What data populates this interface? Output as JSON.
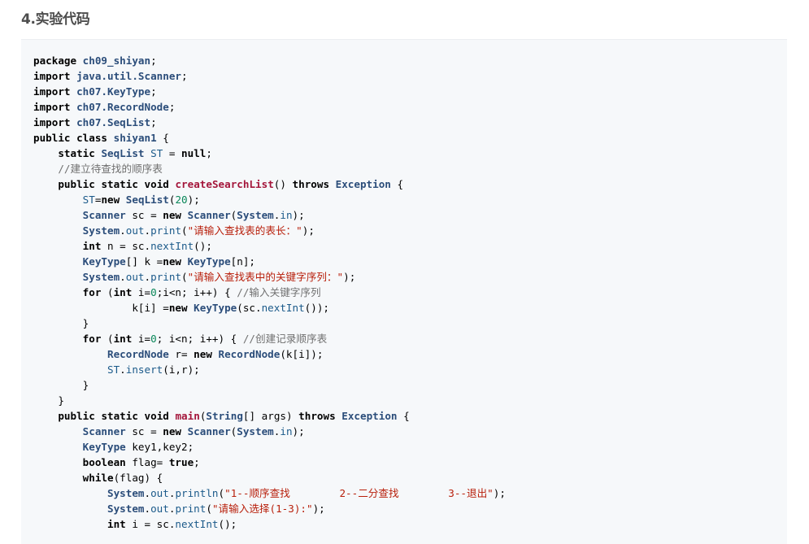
{
  "heading": "4.实验代码",
  "code_lines": [
    [
      [
        "kw",
        "package"
      ],
      [
        "pl",
        " "
      ],
      [
        "ty",
        "ch09_shiyan"
      ],
      [
        "pl",
        ";"
      ]
    ],
    [
      [
        "kw",
        "import"
      ],
      [
        "pl",
        " "
      ],
      [
        "ty",
        "java.util.Scanner"
      ],
      [
        "pl",
        ";"
      ]
    ],
    [
      [
        "kw",
        "import"
      ],
      [
        "pl",
        " "
      ],
      [
        "ty",
        "ch07.KeyType"
      ],
      [
        "pl",
        ";"
      ]
    ],
    [
      [
        "kw",
        "import"
      ],
      [
        "pl",
        " "
      ],
      [
        "ty",
        "ch07.RecordNode"
      ],
      [
        "pl",
        ";"
      ]
    ],
    [
      [
        "kw",
        "import"
      ],
      [
        "pl",
        " "
      ],
      [
        "ty",
        "ch07.SeqList"
      ],
      [
        "pl",
        ";"
      ]
    ],
    [
      [
        "kw",
        "public"
      ],
      [
        "pl",
        " "
      ],
      [
        "kw",
        "class"
      ],
      [
        "pl",
        " "
      ],
      [
        "ty",
        "shiyan1"
      ],
      [
        "pl",
        " {"
      ]
    ],
    [
      [
        "pl",
        "    "
      ],
      [
        "kw",
        "static"
      ],
      [
        "pl",
        " "
      ],
      [
        "ty",
        "SeqList"
      ],
      [
        "pl",
        " "
      ],
      [
        "var",
        "ST"
      ],
      [
        "pl",
        " = "
      ],
      [
        "kw",
        "null"
      ],
      [
        "pl",
        ";"
      ]
    ],
    [
      [
        "pl",
        "    "
      ],
      [
        "cm",
        "//建立待查找的顺序表"
      ]
    ],
    [
      [
        "pl",
        "    "
      ],
      [
        "kw",
        "public"
      ],
      [
        "pl",
        " "
      ],
      [
        "kw",
        "static"
      ],
      [
        "pl",
        " "
      ],
      [
        "kw",
        "void"
      ],
      [
        "pl",
        " "
      ],
      [
        "fnb",
        "createSearchList"
      ],
      [
        "pl",
        "() "
      ],
      [
        "kw",
        "throws"
      ],
      [
        "pl",
        " "
      ],
      [
        "ty",
        "Exception"
      ],
      [
        "pl",
        " {"
      ]
    ],
    [
      [
        "pl",
        "        "
      ],
      [
        "var",
        "ST"
      ],
      [
        "pl",
        "="
      ],
      [
        "kw",
        "new"
      ],
      [
        "pl",
        " "
      ],
      [
        "ty",
        "SeqList"
      ],
      [
        "pl",
        "("
      ],
      [
        "num",
        "20"
      ],
      [
        "pl",
        ");"
      ]
    ],
    [
      [
        "pl",
        "        "
      ],
      [
        "ty",
        "Scanner"
      ],
      [
        "pl",
        " sc = "
      ],
      [
        "kw",
        "new"
      ],
      [
        "pl",
        " "
      ],
      [
        "ty",
        "Scanner"
      ],
      [
        "pl",
        "("
      ],
      [
        "ty",
        "System"
      ],
      [
        "pl",
        "."
      ],
      [
        "fn",
        "in"
      ],
      [
        "pl",
        ");"
      ]
    ],
    [
      [
        "pl",
        "        "
      ],
      [
        "ty",
        "System"
      ],
      [
        "pl",
        "."
      ],
      [
        "fn",
        "out"
      ],
      [
        "pl",
        "."
      ],
      [
        "fn",
        "print"
      ],
      [
        "pl",
        "("
      ],
      [
        "str",
        "\"请输入查找表的表长：\""
      ],
      [
        "pl",
        ");"
      ]
    ],
    [
      [
        "pl",
        "        "
      ],
      [
        "kw",
        "int"
      ],
      [
        "pl",
        " n = sc."
      ],
      [
        "fn",
        "nextInt"
      ],
      [
        "pl",
        "();"
      ]
    ],
    [
      [
        "pl",
        "        "
      ],
      [
        "ty",
        "KeyType"
      ],
      [
        "pl",
        "[] k ="
      ],
      [
        "kw",
        "new"
      ],
      [
        "pl",
        " "
      ],
      [
        "ty",
        "KeyType"
      ],
      [
        "pl",
        "[n];"
      ]
    ],
    [
      [
        "pl",
        "        "
      ],
      [
        "ty",
        "System"
      ],
      [
        "pl",
        "."
      ],
      [
        "fn",
        "out"
      ],
      [
        "pl",
        "."
      ],
      [
        "fn",
        "print"
      ],
      [
        "pl",
        "("
      ],
      [
        "str",
        "\"请输入查找表中的关键字序列：\""
      ],
      [
        "pl",
        ");"
      ]
    ],
    [
      [
        "pl",
        "        "
      ],
      [
        "kw",
        "for"
      ],
      [
        "pl",
        " ("
      ],
      [
        "kw",
        "int"
      ],
      [
        "pl",
        " i="
      ],
      [
        "num",
        "0"
      ],
      [
        "pl",
        ";i<n; i++) { "
      ],
      [
        "cm",
        "//输入关键字序列"
      ]
    ],
    [
      [
        "pl",
        "                k[i] ="
      ],
      [
        "kw",
        "new"
      ],
      [
        "pl",
        " "
      ],
      [
        "ty",
        "KeyType"
      ],
      [
        "pl",
        "(sc."
      ],
      [
        "fn",
        "nextInt"
      ],
      [
        "pl",
        "());"
      ]
    ],
    [
      [
        "pl",
        "        }"
      ]
    ],
    [
      [
        "pl",
        "        "
      ],
      [
        "kw",
        "for"
      ],
      [
        "pl",
        " ("
      ],
      [
        "kw",
        "int"
      ],
      [
        "pl",
        " i="
      ],
      [
        "num",
        "0"
      ],
      [
        "pl",
        "; i<n; i++) { "
      ],
      [
        "cm",
        "//创建记录顺序表"
      ]
    ],
    [
      [
        "pl",
        "            "
      ],
      [
        "ty",
        "RecordNode"
      ],
      [
        "pl",
        " r= "
      ],
      [
        "kw",
        "new"
      ],
      [
        "pl",
        " "
      ],
      [
        "ty",
        "RecordNode"
      ],
      [
        "pl",
        "(k[i]);"
      ]
    ],
    [
      [
        "pl",
        "            "
      ],
      [
        "var",
        "ST"
      ],
      [
        "pl",
        "."
      ],
      [
        "fn",
        "insert"
      ],
      [
        "pl",
        "(i,r);"
      ]
    ],
    [
      [
        "pl",
        "        }"
      ]
    ],
    [
      [
        "pl",
        "    }"
      ]
    ],
    [
      [
        "pl",
        "    "
      ],
      [
        "kw",
        "public"
      ],
      [
        "pl",
        " "
      ],
      [
        "kw",
        "static"
      ],
      [
        "pl",
        " "
      ],
      [
        "kw",
        "void"
      ],
      [
        "pl",
        " "
      ],
      [
        "fnb",
        "main"
      ],
      [
        "pl",
        "("
      ],
      [
        "ty",
        "String"
      ],
      [
        "pl",
        "[] args) "
      ],
      [
        "kw",
        "throws"
      ],
      [
        "pl",
        " "
      ],
      [
        "ty",
        "Exception"
      ],
      [
        "pl",
        " {"
      ]
    ],
    [
      [
        "pl",
        "        "
      ],
      [
        "ty",
        "Scanner"
      ],
      [
        "pl",
        " sc = "
      ],
      [
        "kw",
        "new"
      ],
      [
        "pl",
        " "
      ],
      [
        "ty",
        "Scanner"
      ],
      [
        "pl",
        "("
      ],
      [
        "ty",
        "System"
      ],
      [
        "pl",
        "."
      ],
      [
        "fn",
        "in"
      ],
      [
        "pl",
        ");"
      ]
    ],
    [
      [
        "pl",
        "        "
      ],
      [
        "ty",
        "KeyType"
      ],
      [
        "pl",
        " key1,key2;"
      ]
    ],
    [
      [
        "pl",
        "        "
      ],
      [
        "kw",
        "boolean"
      ],
      [
        "pl",
        " flag= "
      ],
      [
        "kw",
        "true"
      ],
      [
        "pl",
        ";"
      ]
    ],
    [
      [
        "pl",
        "        "
      ],
      [
        "kw",
        "while"
      ],
      [
        "pl",
        "(flag) {"
      ]
    ],
    [
      [
        "pl",
        "            "
      ],
      [
        "ty",
        "System"
      ],
      [
        "pl",
        "."
      ],
      [
        "fn",
        "out"
      ],
      [
        "pl",
        "."
      ],
      [
        "fn",
        "println"
      ],
      [
        "pl",
        "("
      ],
      [
        "str",
        "\"1--顺序查找        2--二分查找        3--退出\""
      ],
      [
        "pl",
        ");"
      ]
    ],
    [
      [
        "pl",
        "            "
      ],
      [
        "ty",
        "System"
      ],
      [
        "pl",
        "."
      ],
      [
        "fn",
        "out"
      ],
      [
        "pl",
        "."
      ],
      [
        "fn",
        "print"
      ],
      [
        "pl",
        "("
      ],
      [
        "str",
        "\"请输入选择(1-3):\""
      ],
      [
        "pl",
        ");"
      ]
    ],
    [
      [
        "pl",
        "            "
      ],
      [
        "kw",
        "int"
      ],
      [
        "pl",
        " i = sc."
      ],
      [
        "fn",
        "nextInt"
      ],
      [
        "pl",
        "();"
      ]
    ]
  ],
  "colors": {
    "background": "#ffffff",
    "code_background": "#f6f8fa",
    "keyword": "#000000",
    "type": "#2b4d7a",
    "string": "#b8200c",
    "number": "#098658",
    "comment": "#707070",
    "method_decl": "#a4163b"
  }
}
